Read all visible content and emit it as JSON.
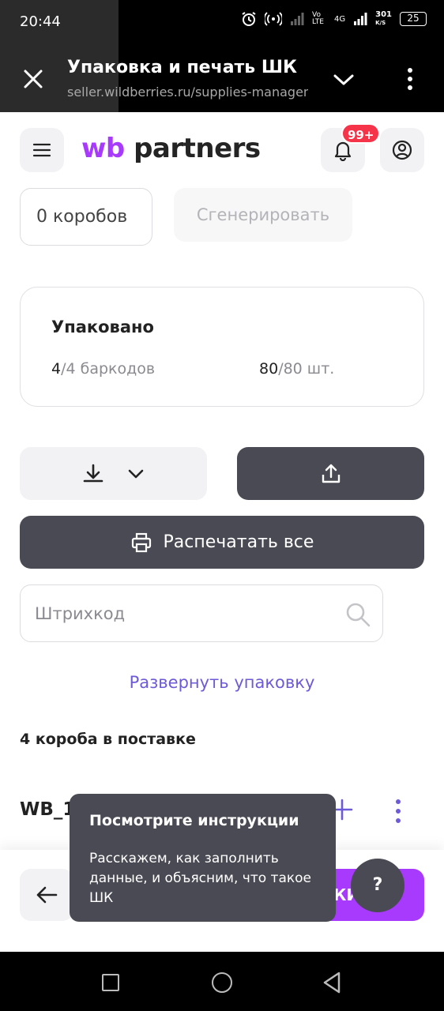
{
  "status_bar": {
    "time": "20:44",
    "net_speed_top": "301",
    "net_speed_bottom": "K/S",
    "network_type": "4G",
    "volte": "Vo LTE",
    "battery": "25",
    "icons": [
      "alarm-icon",
      "hotspot-icon",
      "signal-icon",
      "signal-icon",
      "battery-icon"
    ]
  },
  "browser": {
    "title": "Упаковка и печать ШК",
    "url": "seller.wildberries.ru/supplies-management"
  },
  "header": {
    "logo_wb": "wb",
    "logo_partners": "partners",
    "notification_badge": "99+"
  },
  "controls": {
    "boxes_count": "0 коробов",
    "generate_label": "Сгенерировать"
  },
  "packed": {
    "title": "Упаковано",
    "barcodes_done": "4",
    "barcodes_total": "/4 баркодов",
    "pcs_done": "80",
    "pcs_total": "/80 шт."
  },
  "actions": {
    "print_all_label": "Распечатать все"
  },
  "search": {
    "placeholder": "Штрихкод"
  },
  "expand_link": "Развернуть упаковку",
  "boxes_heading": "4 короба в поставке",
  "row": {
    "label": "WB_1"
  },
  "bottom": {
    "primary_label": "КИ"
  },
  "tooltip": {
    "title": "Посмотрите инструкции",
    "text": "Расскажем, как заполнить данные, и объясним, что такое ШК"
  },
  "help_label": "?",
  "colors": {
    "brand": "#a73afd",
    "dark_button": "#4a4a54",
    "link": "#6d5ad8",
    "badge": "#f5344a"
  }
}
